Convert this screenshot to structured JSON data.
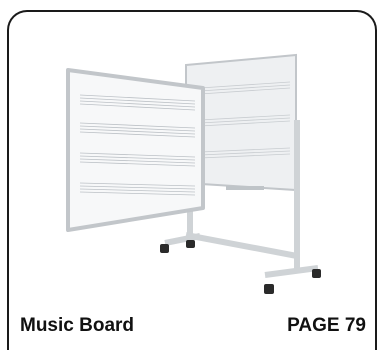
{
  "caption": {
    "title": "Music Board",
    "page": "PAGE 79"
  },
  "image": {
    "subject": "music-whiteboard-on-rolling-stand-icon",
    "colors": {
      "board": "#f6f7f8",
      "frame": "#c9cdd1",
      "stand": "#d6d9dc",
      "staff_lines": "#b7bcc2",
      "wheels": "#2a2a2a",
      "border": "#1a1a1a"
    }
  }
}
